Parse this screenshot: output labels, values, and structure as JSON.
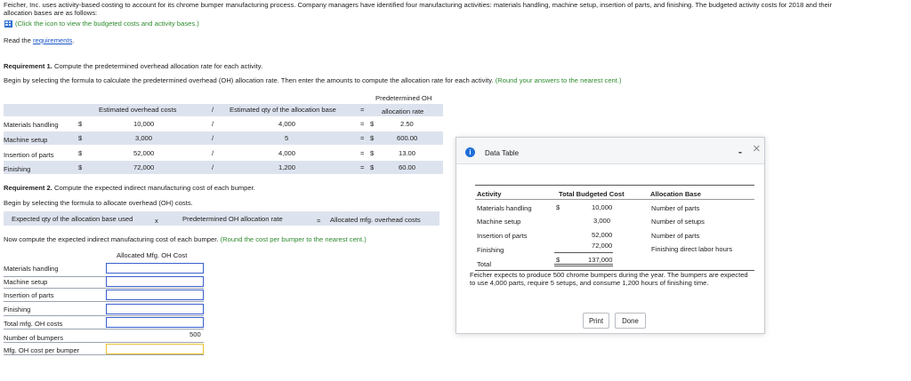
{
  "intro": {
    "line1": "Feicher, Inc. uses activity-based costing to account for its chrome bumper manufacturing process. Company managers have identified four manufacturing activities: materials handling, machine setup, insertion of parts, and finishing. The budgeted activity costs for 2018 and their",
    "line2": "allocation bases are as follows:",
    "click_icon": "(Click the icon to view the budgeted costs and activity bases.)",
    "read_prefix": "Read the ",
    "read_link": "requirements",
    "read_suffix": "."
  },
  "req1": {
    "heading_bold": "Requirement 1.",
    "heading_text": " Compute the predetermined overhead allocation rate for each activity.",
    "instruction": "Begin by selecting the formula to calculate the predetermined overhead (OH) allocation rate. Then enter the amounts to compute the allocation rate for each activity.",
    "instruction_green": "(Round your answers to the nearest cent.)",
    "col_header_rate_line1": "Predetermined OH",
    "col_header_rate_line2": "allocation rate",
    "col_header_costs": "Estimated overhead costs",
    "col_header_qty": "Estimated qty of the allocation base",
    "divide": "/",
    "equals": "=",
    "rows": [
      {
        "label": "Materials handling",
        "cur1": "$",
        "cost": "10,000",
        "qty": "4,000",
        "cur2": "$",
        "rate": "2.50"
      },
      {
        "label": "Machine setup",
        "cur1": "$",
        "cost": "3,000",
        "qty": "5",
        "cur2": "$",
        "rate": "600.00"
      },
      {
        "label": "Insertion of parts",
        "cur1": "$",
        "cost": "52,000",
        "qty": "4,000",
        "cur2": "$",
        "rate": "13.00"
      },
      {
        "label": "Finishing",
        "cur1": "$",
        "cost": "72,000",
        "qty": "1,200",
        "cur2": "$",
        "rate": "60.00"
      }
    ]
  },
  "req2": {
    "heading_bold": "Requirement 2.",
    "heading_text": " Compute the expected indirect manufacturing cost of each bumper.",
    "instruction": "Begin by selecting the formula to allocate overhead (OH) costs.",
    "formula_qty": "Expected qty of the allocation base used",
    "formula_times": "x",
    "formula_rate": "Predetermined OH allocation rate",
    "formula_equals": "=",
    "formula_result": "Allocated mfg. overhead costs",
    "instruction2": "Now compute the expected indirect manufacturing cost of each bumper.",
    "instruction2_green": "(Round the cost per bumper to the nearest cent.)",
    "col_header": "Allocated Mfg. OH Cost",
    "rows": [
      {
        "label": "Materials handling",
        "value": ""
      },
      {
        "label": "Machine setup",
        "value": ""
      },
      {
        "label": "Insertion of parts",
        "value": ""
      },
      {
        "label": "Finishing",
        "value": ""
      },
      {
        "label": "Total mfg. OH costs",
        "value": ""
      },
      {
        "label": "Number of bumpers",
        "value": "500"
      },
      {
        "label": "Mfg. OH cost per bumper",
        "value": ""
      }
    ]
  },
  "modal": {
    "title": "Data Table",
    "info_glyph": "i",
    "minimize": "-",
    "close": "×",
    "col_activity": "Activity",
    "col_cost": "Total Budgeted Cost",
    "col_base": "Allocation Base",
    "rows": [
      {
        "activity": "Materials handling",
        "cur": "$",
        "cost": "10,000",
        "base": "Number of parts"
      },
      {
        "activity": "Machine setup",
        "cur": "",
        "cost": "3,000",
        "base": "Number of setups"
      },
      {
        "activity": "Insertion of parts",
        "cur": "",
        "cost": "52,000",
        "base": "Number of parts"
      },
      {
        "activity": "Finishing",
        "cur": "",
        "cost": "72,000",
        "base": "Finishing direct labor hours"
      }
    ],
    "total_label": "Total",
    "total_cur": "$",
    "total_value": "137,000",
    "note": "Feicher expects to produce 500 chrome bumpers during the year. The bumpers are expected to use 4,000 parts, require 5 setups, and consume 1,200 hours of finishing time.",
    "print_label": "Print",
    "done_label": "Done"
  },
  "colors": {
    "accent_green": "#2e8b2e",
    "link_blue": "#1a55c8",
    "input_border": "#3a5fcd",
    "band": "#dde3ee"
  }
}
